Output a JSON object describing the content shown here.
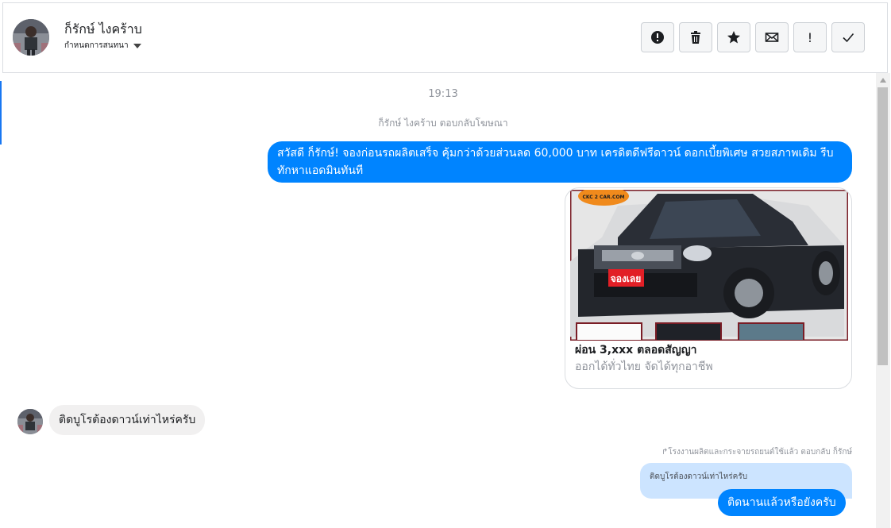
{
  "header": {
    "contact_name": "ก็รักษ์ ไงคร้าบ",
    "assign_label": "กำหนดการสนทนา",
    "toolbar": [
      {
        "name": "spam-button",
        "icon": "alert-circle-icon",
        "glyph": "!"
      },
      {
        "name": "delete-button",
        "icon": "trash-icon",
        "glyph": ""
      },
      {
        "name": "star-button",
        "icon": "star-icon",
        "glyph": ""
      },
      {
        "name": "mark-unread-button",
        "icon": "envelope-icon",
        "glyph": ""
      },
      {
        "name": "important-button",
        "icon": "exclamation-icon",
        "glyph": "!"
      },
      {
        "name": "done-button",
        "icon": "check-icon",
        "glyph": ""
      }
    ]
  },
  "chat": {
    "timestamp": "19:13",
    "reply_note": "ก็รักษ์ ไงคร้าบ ตอบกลับโฆษณา",
    "outgoing_ad_message": "สวัสดี ก็รักษ์! จองก่อนรถผลิตเสร็จ คุ้มกว่าด้วยส่วนลด 60,000 บาท เครดิตดีฟรีดาวน์ ดอกเบี้ยพิเศษ สวยสภาพเดิม รีบทักหาแอดมินทันที",
    "ad_card": {
      "image_badge": "CKC 2 CAR.COM",
      "image_stamp": "จองเลย",
      "title": "ผ่อน 3,xxx ตลอดสัญญา",
      "description": "ออกได้ทั่วไทย จัดได้ทุกอาชีพ"
    },
    "incoming_message": "ติดบูโรต้องดาวน์เท่าไหร่ครับ",
    "reply_meta": "โรงงานผลิตและกระจายรถยนต์ใช้แล้ว ตอบกลับ ก็รักษ์",
    "quoted_message": "ติดบูโรต้องดาวน์เท่าไหร่ครับ",
    "outgoing_reply": "ติดนานแล้วหรือยังครับ"
  },
  "colors": {
    "accent": "#0084ff",
    "incoming_bubble": "#f1f0f0",
    "quoted_bubble": "#cce4ff"
  }
}
